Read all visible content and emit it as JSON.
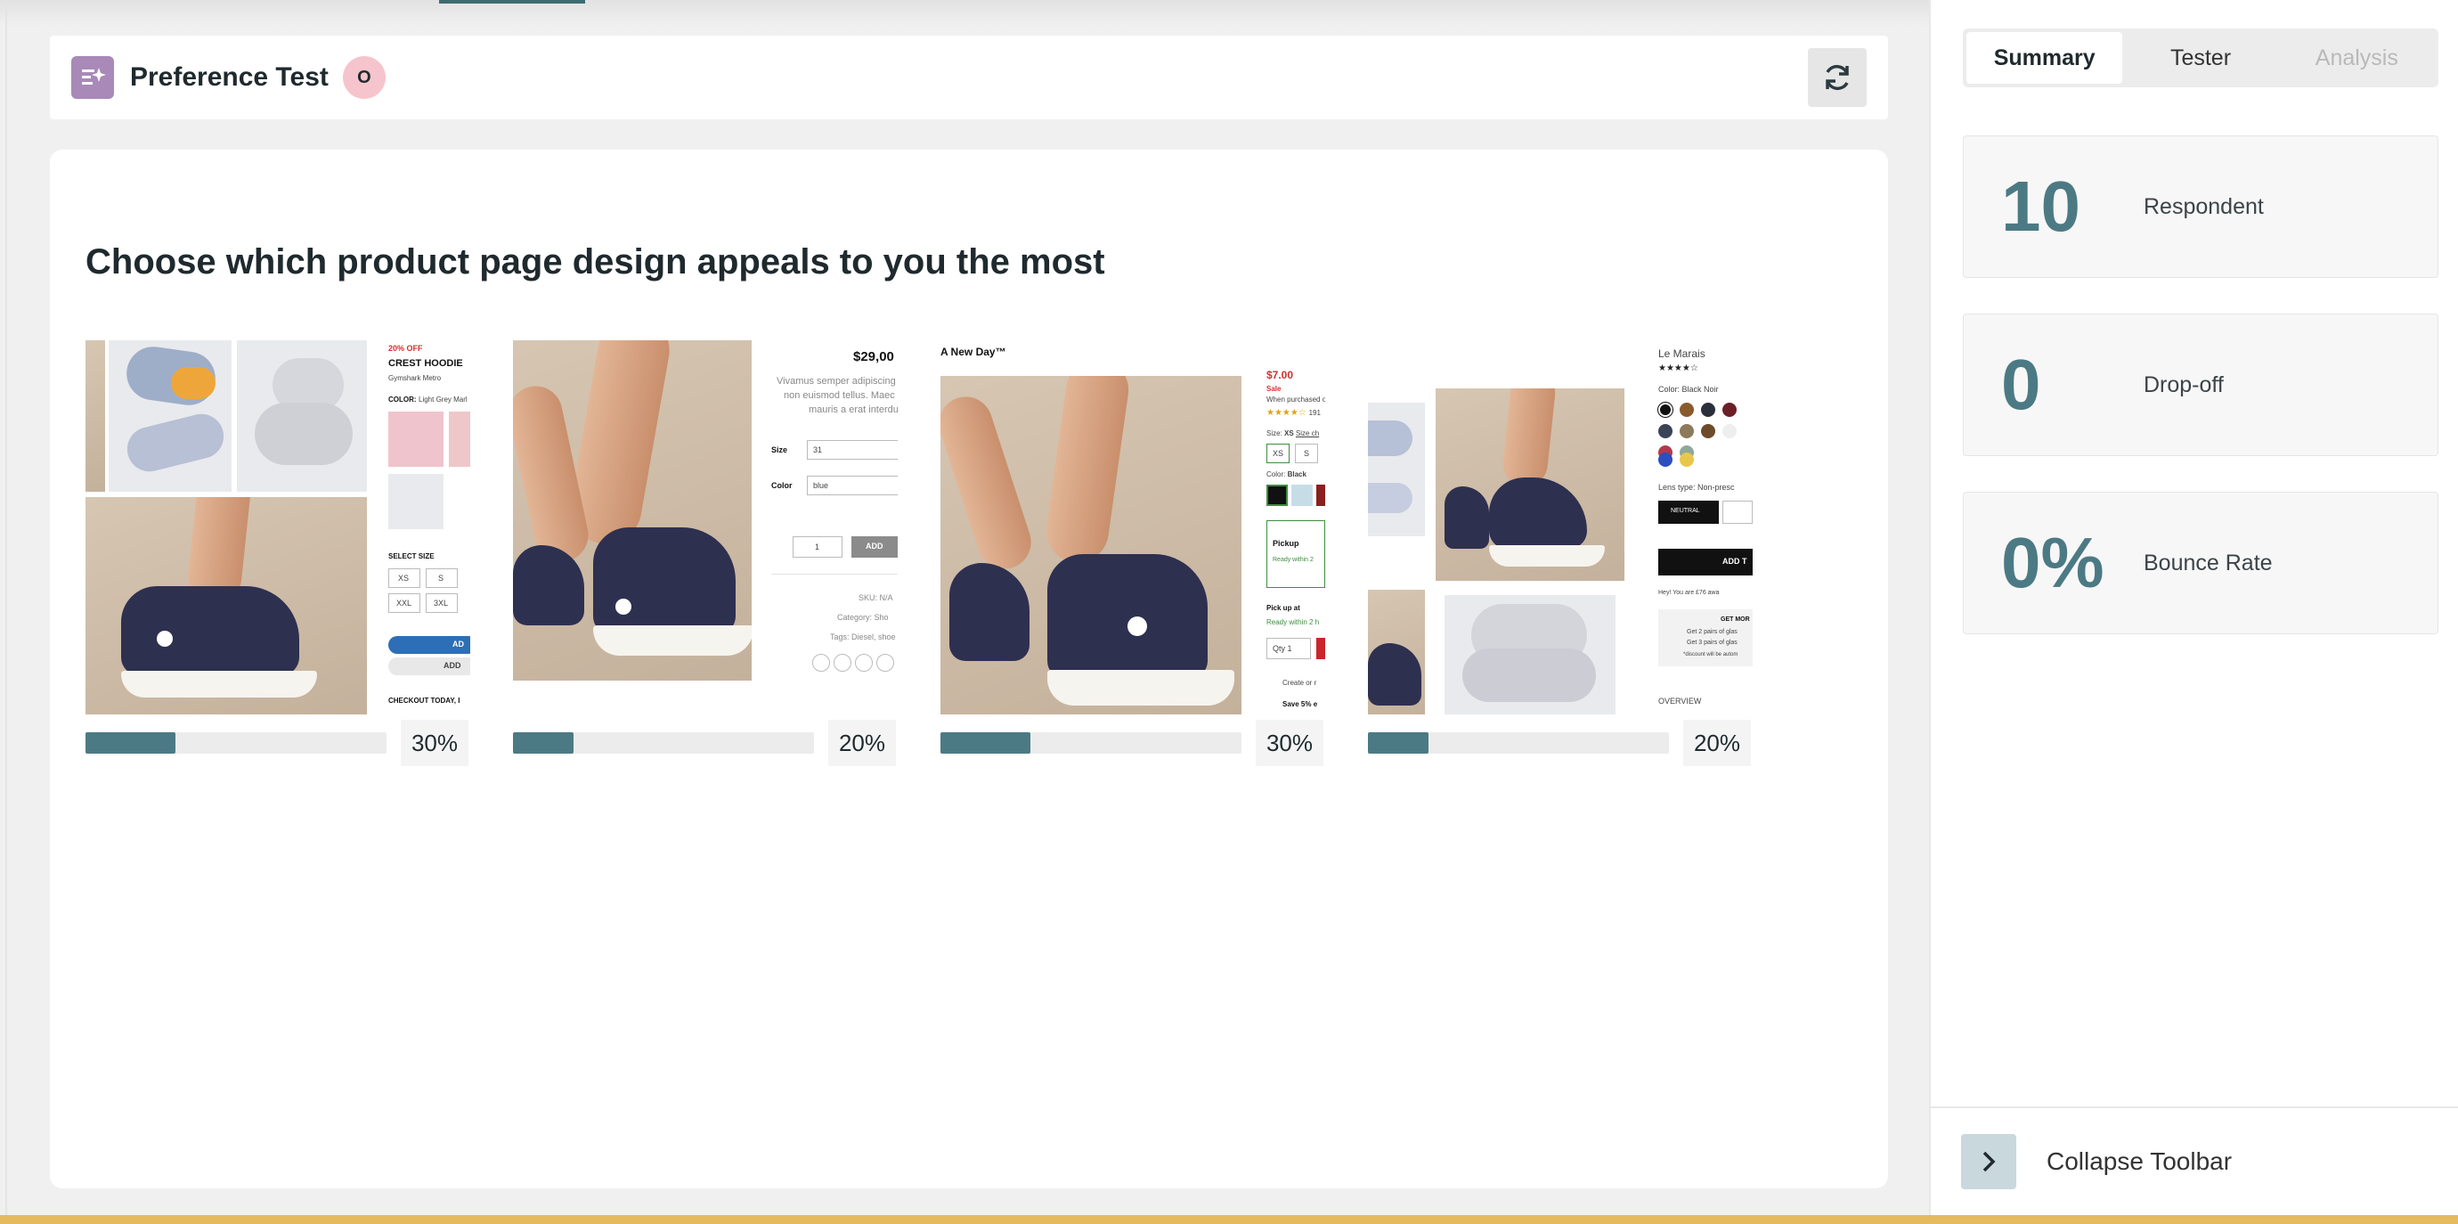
{
  "header": {
    "title": "Preference Test",
    "badge": "O"
  },
  "question": "Choose which product page design appeals to you the most",
  "options": [
    {
      "percent_label": "30%",
      "share": 0.3,
      "page_text": {
        "tag": "20% OFF",
        "title": "CREST HOODIE",
        "brand": "Gymshark Metro",
        "color_label": "COLOR:",
        "color_value": "Light Grey Marl",
        "select_size": "SELECT SIZE",
        "sizes": [
          "XS",
          "S",
          "XXL",
          "3XL"
        ],
        "add": "AD",
        "add2": "ADD",
        "checkout": "CHECKOUT TODAY, I"
      }
    },
    {
      "percent_label": "20%",
      "share": 0.2,
      "page_text": {
        "price": "$29,00",
        "desc1": "Vivamus semper adipiscing",
        "desc2": "non euismod tellus. Maec",
        "desc3": "mauris a erat interdu",
        "size_label": "Size",
        "size_value": "31",
        "color_label": "Color",
        "color_value": "blue",
        "qty": "1",
        "add": "ADD",
        "sku": "SKU: N/A",
        "category": "Category: Sho",
        "tags": "Tags: Diesel, shoe"
      }
    },
    {
      "percent_label": "30%",
      "share": 0.3,
      "page_text": {
        "brand": "A New Day™",
        "price": "$7.00",
        "sale": "Sale",
        "purchased": "When purchased o",
        "rating_count": "191",
        "size_label": "Size:",
        "size_value": "XS",
        "size_chart": "Size ch",
        "sizes": [
          "XS",
          "S"
        ],
        "color_label": "Color:",
        "color_value": "Black",
        "pickup": "Pickup",
        "ready": "Ready within 2",
        "pickup_at": "Pick up at",
        "ready2": "Ready within 2 h",
        "qty": "Qty 1",
        "create": "Create or r",
        "save": "Save 5% e"
      }
    },
    {
      "percent_label": "20%",
      "share": 0.2,
      "page_text": {
        "title": "Le Marais",
        "color_label": "Color: Black Noir",
        "lens": "Lens type: Non-presc",
        "neutral": "NEUTRAL",
        "add": "ADD T",
        "hey": "Hey! You are £76 awa",
        "get_more": "GET MOR",
        "offer1": "Get 2 pairs of glas",
        "offer2": "Get 3 pairs of glas",
        "discount": "*discount will be autom",
        "overview": "OVERVIEW"
      }
    }
  ],
  "sidebar": {
    "tabs": [
      {
        "label": "Summary",
        "state": "active"
      },
      {
        "label": "Tester",
        "state": "normal"
      },
      {
        "label": "Analysis",
        "state": "disabled"
      }
    ],
    "stats": [
      {
        "value": "10",
        "label": "Respondent"
      },
      {
        "value": "0",
        "label": "Drop-off"
      },
      {
        "value": "0%",
        "label": "Bounce Rate"
      }
    ],
    "collapse_label": "Collapse Toolbar"
  },
  "colors": {
    "accent": "#4c7a84",
    "header_icon": "#a889b8",
    "badge": "#f6c4cc",
    "bottom_bar": "#e5b95e"
  },
  "icons": {
    "header": "preference-test-icon",
    "refresh": "refresh-icon",
    "collapse": "chevron-right-icon"
  }
}
